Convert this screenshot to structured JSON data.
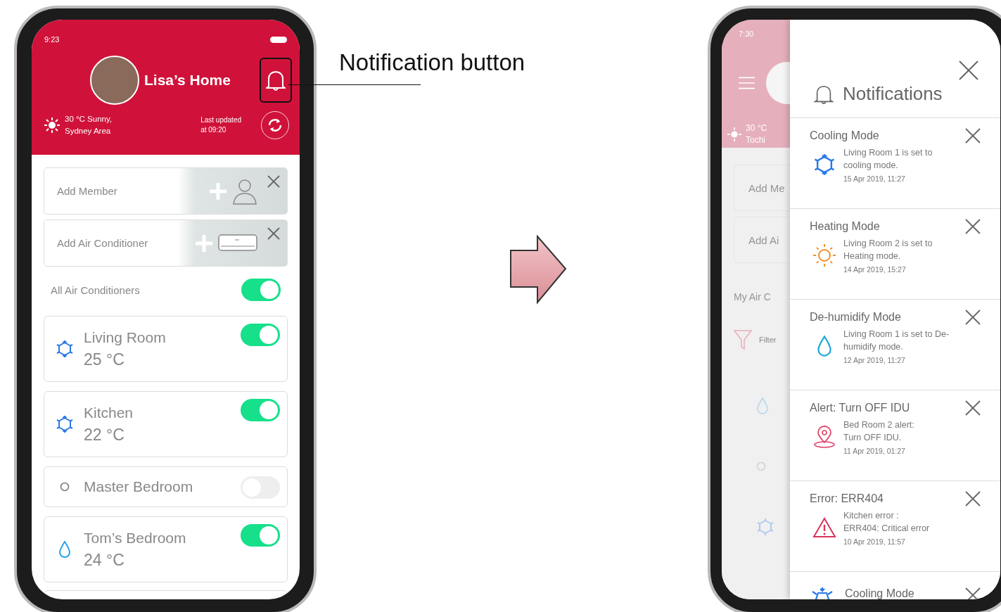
{
  "left_phone": {
    "status_time": "9:23",
    "home_title": "Lisa’s Home",
    "weather_lines": [
      "30 °C Sunny,",
      "Sydney Area"
    ],
    "last_updated_lines": [
      "Last updated",
      "at 09:20"
    ],
    "add_cards": [
      {
        "label": "Add Member",
        "kind": "member"
      },
      {
        "label": "Add Air Conditioner",
        "kind": "ac"
      }
    ],
    "all_toggle": {
      "label": "All Air Conditioners",
      "on": true
    },
    "rooms": [
      {
        "name": "Living Room",
        "temp": "25 °C",
        "kind": "cool",
        "on": true
      },
      {
        "name": "Kitchen",
        "temp": "22 °C",
        "kind": "cool",
        "on": true
      },
      {
        "name": "Master Bedroom",
        "kind": "off",
        "on": false
      },
      {
        "name": "Tom’s Bedroom",
        "temp": "24 °C",
        "kind": "dry",
        "on": true
      }
    ]
  },
  "annotation": {
    "label": "Notification button"
  },
  "right_phone": {
    "status_time": "7:30",
    "background": {
      "weather_lines": [
        "30 °C",
        "Tochi"
      ],
      "add_cards": [
        "Add Me",
        "Add Ai"
      ],
      "section_label": "My Air C",
      "filter_label": "Filter"
    },
    "drawer": {
      "title": "Notifications",
      "items": [
        {
          "kind": "cool",
          "title": "Cooling Mode",
          "lines": [
            "Living Room 1 is set to",
            "cooling mode."
          ],
          "time": "15 Apr 2019, 11:27"
        },
        {
          "kind": "heat",
          "title": "Heating Mode",
          "lines": [
            "Living Room 2 is set to",
            "Heating mode."
          ],
          "time": "14 Apr 2019, 15:27"
        },
        {
          "kind": "dry",
          "title": "De-humidify Mode",
          "lines": [
            "Living Room 1 is set to De-",
            "humidify mode."
          ],
          "time": "12 Apr 2019, 11:27"
        },
        {
          "kind": "alert",
          "title": "Alert: Turn OFF IDU",
          "lines": [
            "Bed Room 2 alert:",
            "Turn OFF IDU."
          ],
          "time": "11 Apr 2019, 01:27"
        },
        {
          "kind": "error",
          "title": "Error: ERR404",
          "lines": [
            "Kitchen error :",
            "ERR404: Critical error"
          ],
          "time": "10 Apr 2019, 11:57"
        }
      ],
      "partial_item": {
        "kind": "cool",
        "title": "Cooling Mode"
      }
    }
  }
}
